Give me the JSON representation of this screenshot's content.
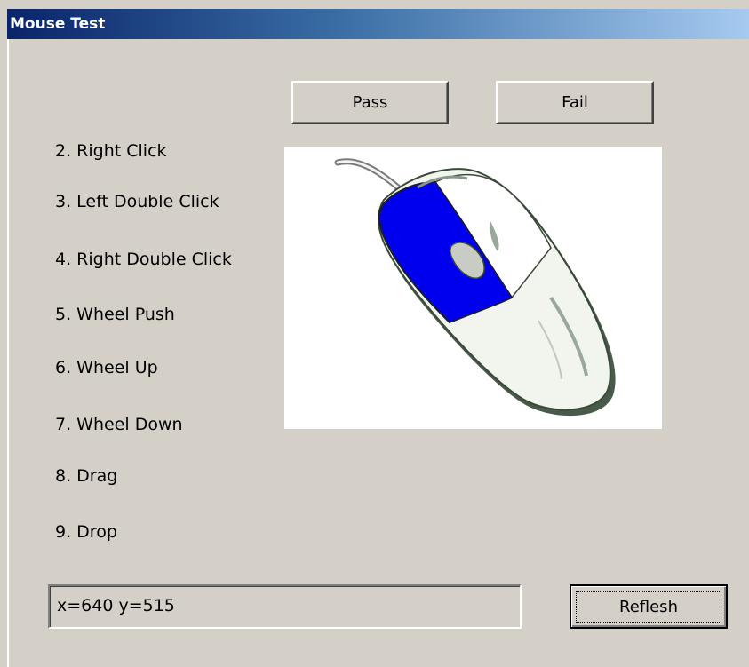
{
  "window": {
    "title": "Mouse Test"
  },
  "buttons": {
    "pass_label": "Pass",
    "fail_label": "Fail",
    "refresh_label": "Reflesh"
  },
  "test_items": [
    "2. Right Click",
    "3. Left Double Click",
    "4. Right Double Click",
    "5. Wheel Push",
    "6. Wheel Up",
    "7. Wheel Down",
    "8. Drag",
    "9. Drop"
  ],
  "coordinates": {
    "text": "x=640 y=515"
  },
  "colors": {
    "window_bg": "#d4d0c8",
    "title_gradient_start": "#0a246a",
    "title_gradient_end": "#a6caf0",
    "mouse_highlight": "#0000ee"
  },
  "mouse_image": {
    "icon": "mouse-illustration",
    "highlighted_button": "left"
  }
}
